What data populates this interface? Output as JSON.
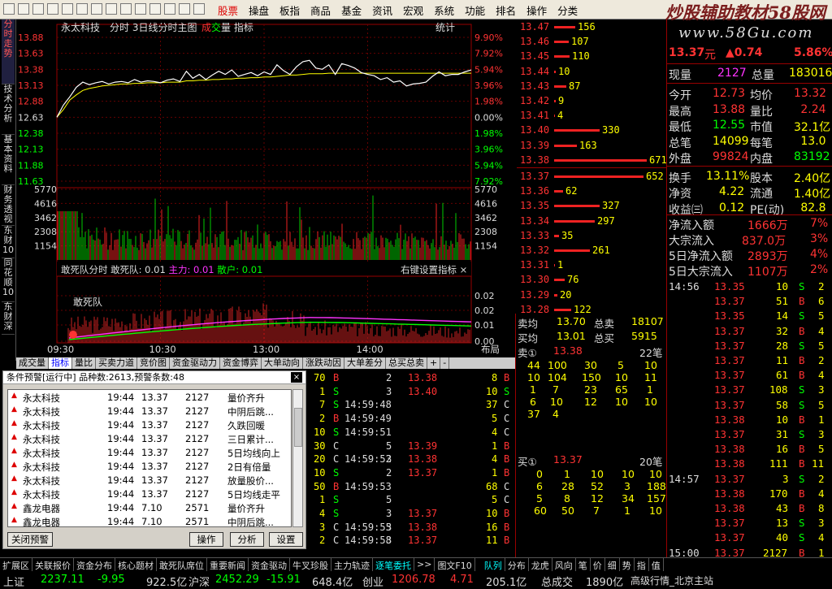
{
  "menu": [
    "股票",
    "操盘",
    "板指",
    "商品",
    "基金",
    "资讯",
    "宏观",
    "系统",
    "功能",
    "排名",
    "操作",
    "分类"
  ],
  "logo": "炒股辅助教材58股网",
  "site": "www.58Gu.com",
  "left_tabs": [
    "分时走势",
    "技术分析",
    "基本资料",
    "财务透视",
    "东财10",
    "同花顺10",
    "东财深"
  ],
  "chart": {
    "stock": "永太科技",
    "title_parts": [
      "分时",
      "3日线分时主图"
    ],
    "cheng": "成",
    "jiao": "交",
    "liang": "量",
    "zhibiao": "指标",
    "tongji": "统计",
    "price_labels": [
      "13.88",
      "13.63",
      "13.38",
      "13.13",
      "12.88",
      "12.63",
      "12.38",
      "12.13",
      "11.88",
      "11.63"
    ],
    "pct_labels": [
      "9.90%",
      "7.92%",
      "5.94%",
      "3.96%",
      "1.98%",
      "0.00%",
      "1.98%",
      "3.96%",
      "5.94%",
      "7.92%"
    ],
    "vol_labels": [
      "5770",
      "4616",
      "3462",
      "2308",
      "1154"
    ],
    "ind_name": "敢死队分时",
    "ind_gsd": "敢死队: 0.01",
    "ind_zl": "主力: 0.01",
    "ind_sh": "散户: 0.01",
    "ind_set": "右键设置指标",
    "ind_close": "×",
    "ind_labels": [
      "0.02",
      "0.02",
      "0.01",
      "0.00"
    ],
    "gsd_label": "敢死队",
    "time_labels": [
      "09:30",
      "10:30",
      "13:00",
      "14:00"
    ],
    "bujv": "布局",
    "price_series": [
      12.63,
      12.82,
      12.95,
      13.1,
      13.18,
      13.14,
      13.17,
      13.19,
      13.15,
      13.18,
      13.19,
      13.17,
      13.22,
      13.18,
      13.2,
      13.19,
      13.17,
      13.21,
      13.23,
      13.19,
      13.35,
      13.24,
      13.3,
      13.22,
      13.29,
      13.35,
      13.3,
      13.37,
      13.27,
      13.3,
      13.33,
      13.28,
      13.34,
      13.3,
      13.45,
      13.36,
      13.3,
      13.42,
      13.5,
      13.52,
      13.4,
      13.38,
      13.45,
      13.3,
      13.47,
      13.44,
      13.4,
      13.33,
      13.3,
      13.28,
      13.22,
      13.25,
      13.18,
      13.2,
      13.12,
      13.15,
      13.16,
      13.18,
      13.27,
      13.34,
      13.28,
      13.3,
      13.3,
      13.34,
      13.37
    ],
    "avg_series": [
      12.63,
      12.75,
      12.9,
      12.98,
      13.05,
      13.08,
      13.1,
      13.12,
      13.13,
      13.14,
      13.15,
      13.15,
      13.16,
      13.16,
      13.17,
      13.17,
      13.17,
      13.18,
      13.18,
      13.18,
      13.2,
      13.2,
      13.21,
      13.21,
      13.22,
      13.22,
      13.23,
      13.23,
      13.24,
      13.24,
      13.25,
      13.25,
      13.26,
      13.26,
      13.27,
      13.28,
      13.29,
      13.29,
      13.3,
      13.31,
      13.31,
      13.31,
      13.32,
      13.32,
      13.32,
      13.32,
      13.32,
      13.32,
      13.32,
      13.32,
      13.32,
      13.32,
      13.32,
      13.32,
      13.32,
      13.32,
      13.32,
      13.32,
      13.32,
      13.32,
      13.32,
      13.32,
      13.32,
      13.32,
      13.32
    ]
  },
  "tabs": [
    "成交量",
    "指标",
    "量比",
    "买卖力道",
    "竞价图",
    "资金驱动力",
    "资金博弈",
    "大单动向",
    "涨跌动因",
    "大单差分",
    "总买总卖",
    "+",
    "-"
  ],
  "orderbook": [
    {
      "p": "13.47",
      "v": "156",
      "w": 26
    },
    {
      "p": "13.46",
      "v": "107",
      "w": 18
    },
    {
      "p": "13.45",
      "v": "110",
      "w": 19
    },
    {
      "p": "13.44",
      "v": "10",
      "w": 2
    },
    {
      "p": "13.43",
      "v": "87",
      "w": 15
    },
    {
      "p": "13.42",
      "v": "9",
      "w": 2
    },
    {
      "p": "13.41",
      "v": "4",
      "w": 1
    },
    {
      "p": "13.40",
      "v": "330",
      "w": 56
    },
    {
      "p": "13.39",
      "v": "163",
      "w": 28
    },
    {
      "p": "13.38",
      "v": "671",
      "w": 114
    },
    {
      "p": "13.37",
      "v": "652",
      "w": 110
    },
    {
      "p": "13.36",
      "v": "62",
      "w": 11
    },
    {
      "p": "13.35",
      "v": "327",
      "w": 56
    },
    {
      "p": "13.34",
      "v": "297",
      "w": 50
    },
    {
      "p": "13.33",
      "v": "35",
      "w": 6
    },
    {
      "p": "13.32",
      "v": "261",
      "w": 44
    },
    {
      "p": "13.31",
      "v": "1",
      "w": 1
    },
    {
      "p": "13.30",
      "v": "76",
      "w": 13
    },
    {
      "p": "13.29",
      "v": "20",
      "w": 4
    },
    {
      "p": "13.28",
      "v": "122",
      "w": 21
    }
  ],
  "mid": {
    "mj_l": "卖均",
    "mj_v": "13.70",
    "zm_l": "总卖",
    "zm_v": "18107",
    "bj_l": "买均",
    "bj_v": "13.01",
    "zb_l": "总买",
    "zb_v": "5915",
    "s1_l": "卖①",
    "s1_p": "13.38",
    "s1_c": "22笔",
    "s1_rows": [
      [
        "44",
        "100",
        "30",
        "5",
        "10"
      ],
      [
        "10",
        "104",
        "150",
        "10",
        "11"
      ],
      [
        "1",
        "7",
        "23",
        "65",
        "1"
      ],
      [
        "6",
        "10",
        "12",
        "10",
        "10"
      ],
      [
        "37",
        "4",
        "",
        "",
        ""
      ]
    ],
    "b1_l": "买①",
    "b1_p": "13.37",
    "b1_c": "20笔",
    "b1_rows": [
      [
        "0",
        "1",
        "10",
        "10",
        "10"
      ],
      [
        "6",
        "28",
        "52",
        "3",
        "188"
      ],
      [
        "5",
        "8",
        "12",
        "34",
        "157"
      ],
      [
        "60",
        "50",
        "7",
        "1",
        "10"
      ]
    ]
  },
  "quote": {
    "price": "13.37",
    "unit": "元",
    "chg": "▲0.74",
    "pct": "5.86%",
    "xianliang_l": "现量",
    "xianliang": "2127",
    "zongliang_l": "总量",
    "zongliang": "183016",
    "rows": [
      [
        "今开",
        "12.73",
        "均价",
        "13.32"
      ],
      [
        "最高",
        "13.88",
        "量比",
        "2.24"
      ],
      [
        "最低",
        "12.55",
        "市值",
        "32.1亿"
      ],
      [
        "总笔",
        "14099",
        "每笔",
        "13.0"
      ],
      [
        "外盘",
        "99824",
        "内盘",
        "83192"
      ],
      [
        "换手",
        "13.11%",
        "股本",
        "2.40亿"
      ],
      [
        "净资",
        "4.22",
        "流通",
        "1.40亿"
      ],
      [
        "收益㈢",
        "0.12",
        "PE(动)",
        "82.8"
      ]
    ],
    "flows": [
      [
        "净流入额",
        "1666万",
        "7%"
      ],
      [
        "大宗流入",
        "837.0万",
        "3%"
      ],
      [
        "5日净流入额",
        "2893万",
        "4%"
      ],
      [
        "5日大宗流入",
        "1107万",
        "2%"
      ]
    ]
  },
  "rticks": [
    [
      "14:56",
      "13.35",
      "10",
      "S",
      "2"
    ],
    [
      "",
      "13.37",
      "51",
      "B",
      "6"
    ],
    [
      "",
      "13.35",
      "14",
      "S",
      "5"
    ],
    [
      "",
      "13.37",
      "32",
      "B",
      "4"
    ],
    [
      "",
      "13.37",
      "28",
      "S",
      "5"
    ],
    [
      "",
      "13.37",
      "11",
      "B",
      "2"
    ],
    [
      "",
      "13.37",
      "61",
      "B",
      "4"
    ],
    [
      "",
      "13.37",
      "108",
      "S",
      "3"
    ],
    [
      "",
      "13.37",
      "58",
      "S",
      "5"
    ],
    [
      "",
      "13.38",
      "10",
      "B",
      "1"
    ],
    [
      "",
      "13.37",
      "31",
      "S",
      "3"
    ],
    [
      "",
      "13.38",
      "16",
      "B",
      "5"
    ],
    [
      "",
      "13.38",
      "111",
      "B",
      "11"
    ],
    [
      "14:57",
      "13.37",
      "3",
      "S",
      "2"
    ],
    [
      "",
      "13.38",
      "170",
      "B",
      "4"
    ],
    [
      "",
      "13.38",
      "43",
      "B",
      "8"
    ],
    [
      "",
      "13.37",
      "13",
      "S",
      "3"
    ],
    [
      "",
      "13.37",
      "40",
      "S",
      "4"
    ],
    [
      "15:00",
      "13.37",
      "2127",
      "B",
      "1"
    ]
  ],
  "lticks": [
    [
      "70",
      "B",
      "",
      "2",
      "13.38",
      "8",
      "B"
    ],
    [
      "1",
      "S",
      "",
      "3",
      "13.40",
      "10",
      "S"
    ],
    [
      "7",
      "S",
      "14:59:48",
      "",
      "",
      "37",
      "C"
    ],
    [
      "2",
      "B",
      "14:59:49",
      "",
      "",
      "5",
      "C"
    ],
    [
      "10",
      "S",
      "14:59:51",
      "",
      "",
      "4",
      "C"
    ],
    [
      "30",
      "C",
      "",
      "5",
      "13.39",
      "1",
      "B"
    ],
    [
      "20",
      "C",
      "14:59:52",
      "3",
      "13.38",
      "4",
      "B"
    ],
    [
      "10",
      "S",
      "",
      "2",
      "13.37",
      "1",
      "B"
    ],
    [
      "50",
      "B",
      "14:59:53",
      "",
      "",
      "68",
      "C"
    ],
    [
      "1",
      "S",
      "",
      "5",
      "",
      "5",
      "C"
    ],
    [
      "4",
      "S",
      "",
      "3",
      "13.37",
      "10",
      "B"
    ],
    [
      "3",
      "C",
      "14:59:55",
      "3",
      "13.38",
      "16",
      "B"
    ],
    [
      "2",
      "C",
      "14:59:58",
      "3",
      "13.37",
      "11",
      "B"
    ]
  ],
  "alert": {
    "title": "条件预警[运行中] 品种数:2613,预警条数:48",
    "rows": [
      [
        "永太科技",
        "19:44",
        "13.37",
        "2127",
        "量价齐升"
      ],
      [
        "永太科技",
        "19:44",
        "13.37",
        "2127",
        "中阴后跳..."
      ],
      [
        "永太科技",
        "19:44",
        "13.37",
        "2127",
        "久跌回暖"
      ],
      [
        "永太科技",
        "19:44",
        "13.37",
        "2127",
        "三日累计..."
      ],
      [
        "永太科技",
        "19:44",
        "13.37",
        "2127",
        "5日均线向上"
      ],
      [
        "永太科技",
        "19:44",
        "13.37",
        "2127",
        "2日有倍量"
      ],
      [
        "永太科技",
        "19:44",
        "13.37",
        "2127",
        "放量股价..."
      ],
      [
        "永太科技",
        "19:44",
        "13.37",
        "2127",
        "5日均线走平"
      ],
      [
        "鑫龙电器",
        "19:44",
        "7.10",
        "2571",
        "量价齐升"
      ],
      [
        "鑫龙电器",
        "19:44",
        "7.10",
        "2571",
        "中阴后跳..."
      ]
    ],
    "close_btn": "关闭预警",
    "op_btn": "操作",
    "an_btn": "分析",
    "set_btn": "设置"
  },
  "bottom_tabs": [
    "扩展区",
    "关联报价",
    "资金分布",
    "核心题材",
    "敢死队席位",
    "重要新闻",
    "资金驱动",
    "牛叉珍股",
    "主力轨迹",
    "逐笔委托",
    ">>",
    "图文F10",
    "队列",
    "分布",
    "龙虎",
    "风向",
    "笔",
    "价",
    "细",
    "势",
    "指",
    "值"
  ],
  "index_bar": {
    "sh_l": "上证",
    "sh": "2237.11",
    "sh_c": "-9.95",
    "sh_a": "922.5亿",
    "hs_l": "沪深",
    "hs": "2452.29",
    "hs_c": "-15.91",
    "hs_a": "648.4亿",
    "cy_l": "创业",
    "cy": "1206.78",
    "cy_c": "4.71",
    "cy_a": "205.1亿",
    "zcj_l": "总成交",
    "zcj": "1890亿",
    "gj": "高级行情_北京主站"
  }
}
